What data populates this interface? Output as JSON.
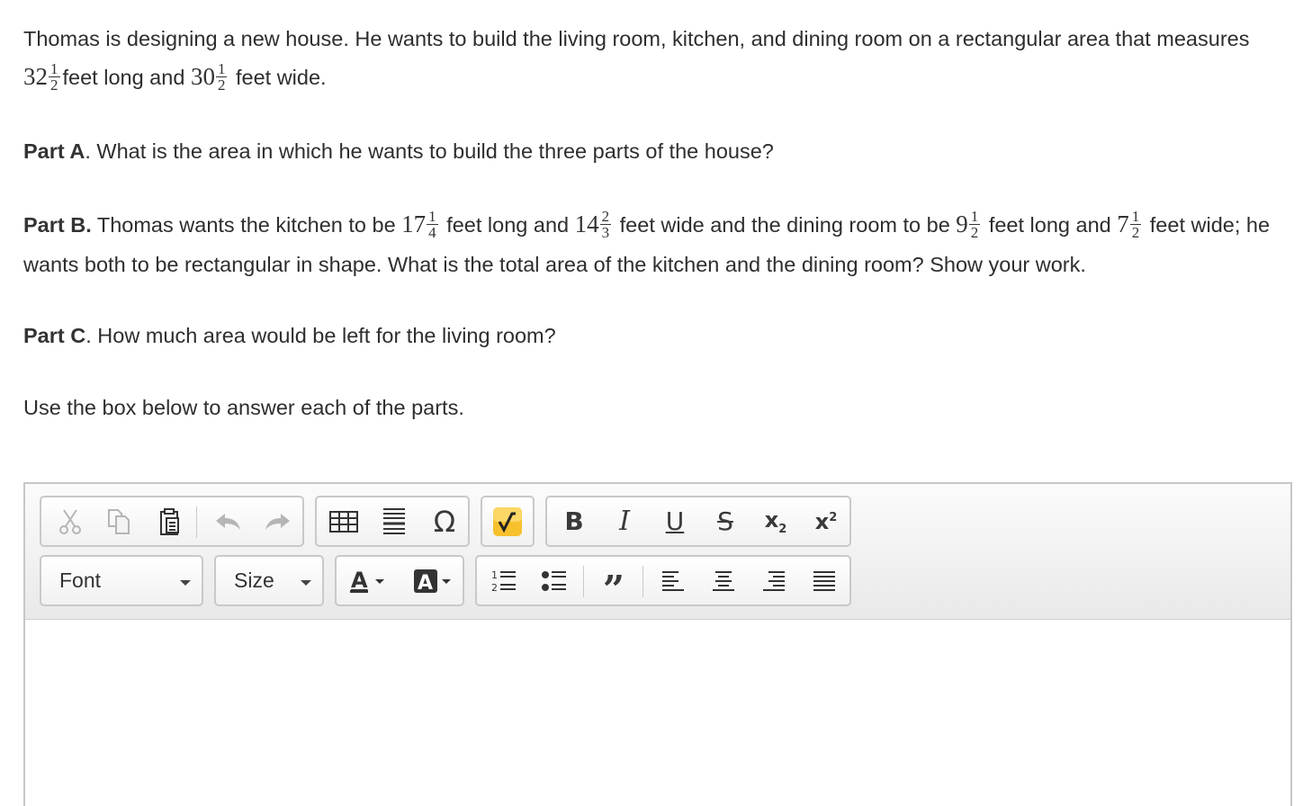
{
  "question": {
    "intro": {
      "pre": "Thomas is designing a new house. He wants to build the living room, kitchen, and dining room on a rectangular area that measures ",
      "len_whole": "32",
      "len_num": "1",
      "len_den": "2",
      "mid": "feet long and ",
      "wid_whole": "30",
      "wid_num": "1",
      "wid_den": "2",
      "post": " feet wide."
    },
    "part_a": {
      "label": "Part A",
      "text": ". What is the area in which he wants to build the three parts of the house?"
    },
    "part_b": {
      "label": "Part B.",
      "t1": " Thomas wants the kitchen to be ",
      "k_len_whole": "17",
      "k_len_num": "1",
      "k_len_den": "4",
      "t2": " feet long and  ",
      "k_wid_whole": "14",
      "k_wid_num": "2",
      "k_wid_den": "3",
      "t3": " feet wide and the dining room to be ",
      "d_len_whole": "9",
      "d_len_num": "1",
      "d_len_den": "2",
      "t4": " feet long and ",
      "d_wid_whole": "7",
      "d_wid_num": "1",
      "d_wid_den": "2",
      "t5": " feet wide; he wants both to be rectangular in shape. What is the total area of the kitchen and the dining room? Show your work."
    },
    "part_c": {
      "label": "Part C",
      "text": ". How much area would be left for the living room?"
    },
    "instruction": "Use the box below to answer each of the parts."
  },
  "editor": {
    "font_label": "Font",
    "size_label": "Size",
    "icons": {
      "cut": "cut-icon",
      "copy": "copy-icon",
      "paste": "paste-icon",
      "undo": "undo-icon",
      "redo": "redo-icon",
      "table": "table-icon",
      "horizontal_line": "horizontal-line-icon",
      "special_char": "omega-icon",
      "math": "square-root-icon",
      "bold": "bold-icon",
      "italic": "italic-icon",
      "underline": "underline-icon",
      "strike": "strikethrough-icon",
      "subscript": "subscript-icon",
      "superscript": "superscript-icon",
      "text_color": "text-color-icon",
      "bg_color": "background-color-icon",
      "numbered_list": "numbered-list-icon",
      "bulleted_list": "bulleted-list-icon",
      "blockquote": "blockquote-icon",
      "align_left": "align-left-icon",
      "align_center": "align-center-icon",
      "align_right": "align-right-icon",
      "justify": "justify-icon"
    },
    "colors": {
      "math_button_bg": "#f7c12e",
      "icon": "#333333",
      "disabled_icon": "#b5b5b5"
    }
  }
}
